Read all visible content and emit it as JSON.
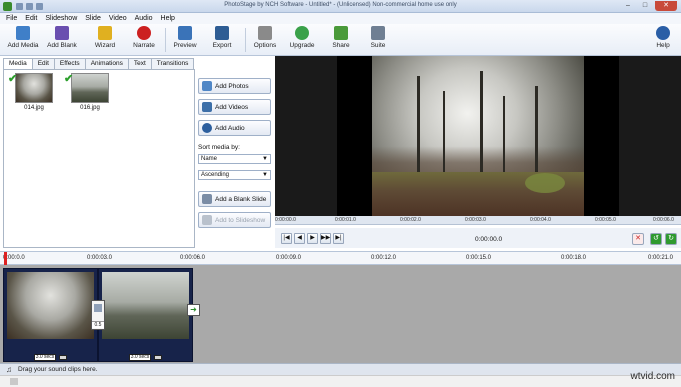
{
  "window": {
    "title": "PhotoStage by NCH Software - Untitled* - (Unlicensed) Non-commercial home use only",
    "controls": {
      "minimize": "–",
      "maximize": "□",
      "close": "✕"
    }
  },
  "menu": [
    "File",
    "Edit",
    "Slideshow",
    "Slide",
    "Video",
    "Audio",
    "Help"
  ],
  "toolbar": {
    "add_media": "Add Media",
    "add_blank": "Add Blank",
    "wizard": "Wizard",
    "narrate": "Narrate",
    "preview": "Preview",
    "export": "Export",
    "options": "Options",
    "upgrade": "Upgrade",
    "share": "Share",
    "suite": "Suite",
    "help": "Help"
  },
  "tabs": [
    "Media",
    "Edit",
    "Effects",
    "Animations",
    "Text",
    "Transitions"
  ],
  "media": [
    {
      "filename": "014.jpg"
    },
    {
      "filename": "016.jpg"
    }
  ],
  "side": {
    "add_photos": "Add Photos",
    "add_videos": "Add Videos",
    "add_audio": "Add Audio",
    "sort_label": "Sort media by:",
    "sort_by": "Name",
    "sort_order": "Ascending",
    "add_blank_slide": "Add a Blank Slide",
    "add_to_slideshow": "Add to Slideshow"
  },
  "preview": {
    "scrub_labels": [
      "0:00:00.0",
      "0:00:01.0",
      "0:00:02.0",
      "0:00:03.0",
      "0:00:04.0",
      "0:00:05.0",
      "0:00:06.0"
    ],
    "timecode": "0:00:00.0",
    "transport": [
      "|◀",
      "◀",
      "▶",
      "▶▶",
      "▶|"
    ]
  },
  "timeline": {
    "ruler": [
      "0:00:0.0",
      "0:00:03.0",
      "0:00:06.0",
      "0:00:09.0",
      "0:00:12.0",
      "0:00:15.0",
      "0:00:18.0",
      "0:00:21.0"
    ],
    "clips": [
      {
        "duration": "3.0 secs"
      },
      {
        "duration": "3.0 secs"
      }
    ],
    "transition_value": "0.5",
    "sound_hint": "Drag your sound clips here."
  },
  "watermark": "wtvid.com",
  "colors": {
    "accent": "#2da02d",
    "playhead": "#dd2222",
    "clip_bg": "#17234a"
  }
}
